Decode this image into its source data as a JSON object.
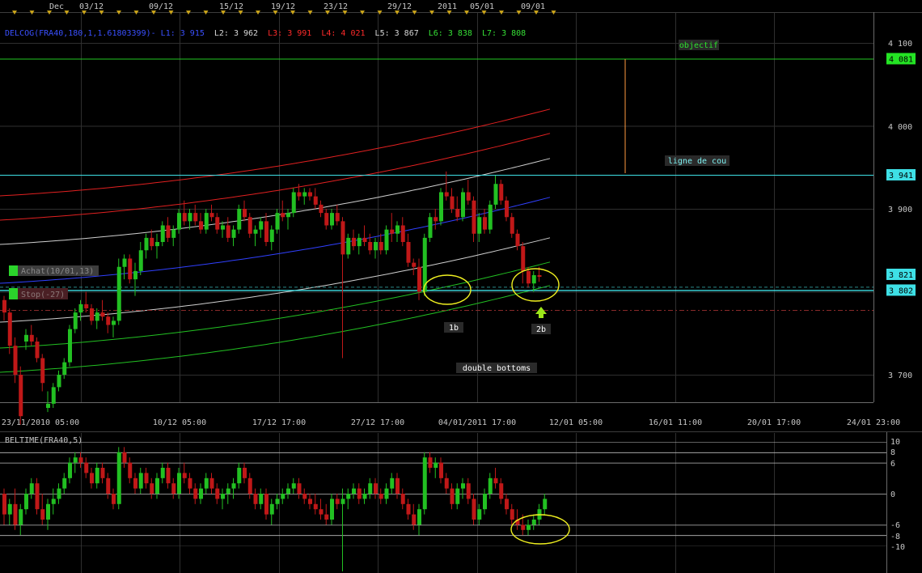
{
  "top_dates": [
    "Dec",
    "03/12",
    "09/12",
    "15/12",
    "19/12",
    "23/12",
    "29/12",
    "2011",
    "05/01",
    "09/01"
  ],
  "main_indicator": {
    "head": "DELCOG(FRA40,180,1,1.61803399)-",
    "levels": [
      {
        "label": "L1: 3 915",
        "color": "#3a50ff"
      },
      {
        "label": "L2: 3 962",
        "color": "#d8d8d8"
      },
      {
        "label": "L3: 3 991",
        "color": "#ff2a2a"
      },
      {
        "label": "L4: 4 021",
        "color": "#ff2a2a"
      },
      {
        "label": "L5: 3 867",
        "color": "#d8d8d8"
      },
      {
        "label": "L6: 3 838",
        "color": "#36e036"
      },
      {
        "label": "L7: 3 808",
        "color": "#36e036"
      }
    ]
  },
  "annotations": {
    "objectif": "objectif",
    "ligne_de_cou": "ligne de cou",
    "b1": "1b",
    "b2": "2b",
    "double_bottoms": "double bottoms"
  },
  "orders": {
    "achat": "Achat(10/01,13)",
    "stop": "Stop(-27)"
  },
  "price_axis": {
    "ticks": [
      "4 100",
      "4 000",
      "3 900",
      "3 700"
    ],
    "tags": [
      {
        "label": "4 081",
        "value": 4081,
        "bg": "#24e424"
      },
      {
        "label": "3 941",
        "value": 3941,
        "bg": "#3ee0e6"
      },
      {
        "label": "3 821",
        "value": 3821,
        "bg": "#3ee0e6"
      },
      {
        "label": "3 802",
        "value": 3802,
        "bg": "#3ee0e6"
      }
    ]
  },
  "bottom_dates": [
    "23/11/2010 05:00",
    "10/12 05:00",
    "17/12 17:00",
    "27/12 17:00",
    "04/01/2011 17:00",
    "12/01 05:00",
    "16/01 11:00",
    "20/01 17:00",
    "24/01 23:00"
  ],
  "sub_indicator": {
    "title": "BELTIME(FRA40,5)",
    "ticks": [
      "10",
      "8",
      "6",
      "0",
      "-6",
      "-8",
      "-10"
    ]
  },
  "chart_data": [
    {
      "type": "candlestick",
      "title": "DELCOG(FRA40,180,1,1.61803399)",
      "ylim": [
        3660,
        4135
      ],
      "series": [
        {
          "name": "L1",
          "value": 3915
        },
        {
          "name": "L2",
          "value": 3962
        },
        {
          "name": "L3",
          "value": 3991
        },
        {
          "name": "L4",
          "value": 4021
        },
        {
          "name": "L5",
          "value": 3867
        },
        {
          "name": "L6",
          "value": 3838
        },
        {
          "name": "L7",
          "value": 3808
        }
      ],
      "horizontal_levels": [
        4081,
        3941,
        3821,
        3802
      ],
      "candles": [
        [
          3790,
          3795,
          3765,
          3775
        ],
        [
          3775,
          3780,
          3725,
          3735
        ],
        [
          3735,
          3745,
          3690,
          3700
        ],
        [
          3700,
          3710,
          3640,
          3650
        ],
        [
          3740,
          3755,
          3730,
          3748
        ],
        [
          3748,
          3760,
          3735,
          3740
        ],
        [
          3740,
          3745,
          3715,
          3720
        ],
        [
          3720,
          3725,
          3680,
          3690
        ],
        [
          3660,
          3680,
          3655,
          3665
        ],
        [
          3665,
          3690,
          3660,
          3685
        ],
        [
          3685,
          3705,
          3680,
          3700
        ],
        [
          3700,
          3720,
          3695,
          3715
        ],
        [
          3715,
          3760,
          3710,
          3755
        ],
        [
          3755,
          3780,
          3750,
          3775
        ],
        [
          3775,
          3790,
          3765,
          3785
        ],
        [
          3785,
          3800,
          3775,
          3780
        ],
        [
          3780,
          3785,
          3760,
          3765
        ],
        [
          3765,
          3780,
          3755,
          3775
        ],
        [
          3775,
          3790,
          3765,
          3770
        ],
        [
          3770,
          3775,
          3750,
          3760
        ],
        [
          3760,
          3770,
          3745,
          3765
        ],
        [
          3765,
          3840,
          3760,
          3830
        ],
        [
          3830,
          3845,
          3815,
          3840
        ],
        [
          3840,
          3845,
          3810,
          3815
        ],
        [
          3815,
          3835,
          3795,
          3825
        ],
        [
          3825,
          3860,
          3820,
          3850
        ],
        [
          3850,
          3870,
          3840,
          3865
        ],
        [
          3865,
          3875,
          3850,
          3855
        ],
        [
          3855,
          3870,
          3840,
          3860
        ],
        [
          3860,
          3885,
          3855,
          3880
        ],
        [
          3880,
          3890,
          3860,
          3865
        ],
        [
          3865,
          3880,
          3855,
          3875
        ],
        [
          3875,
          3900,
          3870,
          3895
        ],
        [
          3895,
          3910,
          3880,
          3885
        ],
        [
          3885,
          3900,
          3875,
          3895
        ],
        [
          3895,
          3905,
          3880,
          3885
        ],
        [
          3885,
          3895,
          3870,
          3875
        ],
        [
          3875,
          3900,
          3870,
          3895
        ],
        [
          3895,
          3905,
          3885,
          3890
        ],
        [
          3890,
          3895,
          3870,
          3875
        ],
        [
          3875,
          3885,
          3865,
          3880
        ],
        [
          3880,
          3890,
          3860,
          3865
        ],
        [
          3865,
          3880,
          3855,
          3875
        ],
        [
          3875,
          3905,
          3870,
          3900
        ],
        [
          3900,
          3910,
          3885,
          3890
        ],
        [
          3890,
          3895,
          3865,
          3870
        ],
        [
          3870,
          3880,
          3855,
          3875
        ],
        [
          3875,
          3890,
          3865,
          3885
        ],
        [
          3885,
          3895,
          3855,
          3860
        ],
        [
          3860,
          3880,
          3850,
          3875
        ],
        [
          3875,
          3900,
          3870,
          3895
        ],
        [
          3895,
          3910,
          3885,
          3890
        ],
        [
          3890,
          3900,
          3875,
          3895
        ],
        [
          3895,
          3925,
          3890,
          3920
        ],
        [
          3920,
          3930,
          3910,
          3915
        ],
        [
          3915,
          3925,
          3905,
          3920
        ],
        [
          3920,
          3925,
          3910,
          3915
        ],
        [
          3915,
          3925,
          3900,
          3905
        ],
        [
          3905,
          3910,
          3890,
          3895
        ],
        [
          3895,
          3900,
          3875,
          3880
        ],
        [
          3880,
          3900,
          3875,
          3895
        ],
        [
          3895,
          3905,
          3880,
          3885
        ],
        [
          3885,
          3890,
          3720,
          3845
        ],
        [
          3845,
          3870,
          3840,
          3865
        ],
        [
          3865,
          3875,
          3850,
          3855
        ],
        [
          3855,
          3870,
          3845,
          3865
        ],
        [
          3865,
          3880,
          3855,
          3860
        ],
        [
          3860,
          3870,
          3845,
          3850
        ],
        [
          3850,
          3865,
          3840,
          3860
        ],
        [
          3860,
          3870,
          3845,
          3850
        ],
        [
          3850,
          3880,
          3845,
          3875
        ],
        [
          3875,
          3895,
          3860,
          3870
        ],
        [
          3870,
          3885,
          3860,
          3880
        ],
        [
          3880,
          3890,
          3855,
          3860
        ],
        [
          3860,
          3870,
          3830,
          3835
        ],
        [
          3835,
          3840,
          3820,
          3830
        ],
        [
          3830,
          3840,
          3790,
          3800
        ],
        [
          3800,
          3870,
          3795,
          3865
        ],
        [
          3865,
          3895,
          3860,
          3890
        ],
        [
          3890,
          3900,
          3875,
          3885
        ],
        [
          3885,
          3925,
          3880,
          3920
        ],
        [
          3920,
          3945,
          3910,
          3915
        ],
        [
          3915,
          3925,
          3895,
          3900
        ],
        [
          3900,
          3915,
          3885,
          3890
        ],
        [
          3890,
          3925,
          3885,
          3920
        ],
        [
          3920,
          3935,
          3905,
          3910
        ],
        [
          3910,
          3915,
          3860,
          3870
        ],
        [
          3870,
          3895,
          3860,
          3890
        ],
        [
          3890,
          3900,
          3870,
          3875
        ],
        [
          3875,
          3910,
          3870,
          3905
        ],
        [
          3905,
          3940,
          3900,
          3930
        ],
        [
          3930,
          3935,
          3905,
          3910
        ],
        [
          3910,
          3915,
          3885,
          3890
        ],
        [
          3890,
          3895,
          3865,
          3870
        ],
        [
          3870,
          3875,
          3850,
          3855
        ],
        [
          3855,
          3860,
          3810,
          3825
        ],
        [
          3825,
          3830,
          3805,
          3810
        ],
        [
          3810,
          3825,
          3800,
          3820
        ],
        [
          3820,
          3830,
          3812,
          3818
        ]
      ]
    },
    {
      "type": "candlestick",
      "title": "BELTIME(FRA40,5)",
      "ylim": [
        -11,
        11
      ],
      "candles": [
        [
          0,
          1,
          -6,
          -4
        ],
        [
          -4,
          -1,
          -6,
          -2
        ],
        [
          -2,
          1,
          -7,
          -6
        ],
        [
          -6,
          -2,
          -8,
          -3
        ],
        [
          -3,
          1,
          -4,
          0
        ],
        [
          0,
          3,
          -1,
          2
        ],
        [
          2,
          3,
          -4,
          -3
        ],
        [
          -3,
          0,
          -6,
          -5
        ],
        [
          -5,
          -1,
          -7,
          -2
        ],
        [
          -2,
          1,
          -4,
          -1
        ],
        [
          -1,
          2,
          -2,
          1
        ],
        [
          1,
          4,
          0,
          3
        ],
        [
          3,
          7,
          2,
          6
        ],
        [
          6,
          8,
          4,
          7
        ],
        [
          7,
          8,
          5,
          6
        ],
        [
          6,
          7,
          3,
          4
        ],
        [
          4,
          5,
          1,
          2
        ],
        [
          2,
          6,
          1,
          5
        ],
        [
          5,
          6,
          2,
          3
        ],
        [
          3,
          4,
          -1,
          0
        ],
        [
          0,
          1,
          -3,
          -2
        ],
        [
          -2,
          9,
          -3,
          8
        ],
        [
          8,
          9,
          5,
          6
        ],
        [
          6,
          7,
          2,
          3
        ],
        [
          3,
          4,
          0,
          1
        ],
        [
          1,
          5,
          0,
          4
        ],
        [
          4,
          5,
          1,
          2
        ],
        [
          2,
          3,
          -1,
          0
        ],
        [
          0,
          4,
          -1,
          3
        ],
        [
          3,
          6,
          2,
          5
        ],
        [
          5,
          6,
          1,
          2
        ],
        [
          2,
          3,
          -1,
          0
        ],
        [
          0,
          5,
          -1,
          4
        ],
        [
          4,
          6,
          2,
          3
        ],
        [
          3,
          4,
          0,
          1
        ],
        [
          1,
          2,
          -2,
          -1
        ],
        [
          -1,
          2,
          -2,
          1
        ],
        [
          1,
          4,
          0,
          3
        ],
        [
          3,
          4,
          0,
          1
        ],
        [
          1,
          2,
          -2,
          -1
        ],
        [
          -1,
          1,
          -3,
          0
        ],
        [
          0,
          2,
          -2,
          1
        ],
        [
          1,
          3,
          -1,
          2
        ],
        [
          2,
          6,
          1,
          5
        ],
        [
          5,
          6,
          2,
          3
        ],
        [
          3,
          4,
          -1,
          0
        ],
        [
          0,
          1,
          -3,
          -2
        ],
        [
          -2,
          1,
          -3,
          0
        ],
        [
          0,
          1,
          -5,
          -4
        ],
        [
          -4,
          -1,
          -6,
          -2
        ],
        [
          -2,
          0,
          -3,
          -1
        ],
        [
          -1,
          1,
          -2,
          0
        ],
        [
          0,
          2,
          -1,
          1
        ],
        [
          1,
          3,
          0,
          2
        ],
        [
          2,
          3,
          -1,
          0
        ],
        [
          0,
          1,
          -2,
          -1
        ],
        [
          -1,
          0,
          -3,
          -2
        ],
        [
          -2,
          0,
          -4,
          -3
        ],
        [
          -3,
          -1,
          -5,
          -4
        ],
        [
          -4,
          -2,
          -6,
          -5
        ],
        [
          -5,
          0,
          -6,
          -1
        ],
        [
          -1,
          0,
          -3,
          -2
        ],
        [
          -2,
          1,
          -18,
          -1
        ],
        [
          -1,
          1,
          -3,
          0
        ],
        [
          0,
          2,
          -1,
          1
        ],
        [
          1,
          2,
          -2,
          -1
        ],
        [
          -1,
          1,
          -2,
          0
        ],
        [
          0,
          3,
          -1,
          2
        ],
        [
          2,
          3,
          -1,
          0
        ],
        [
          0,
          1,
          -2,
          -1
        ],
        [
          -1,
          2,
          -2,
          1
        ],
        [
          1,
          4,
          0,
          3
        ],
        [
          3,
          4,
          -1,
          0
        ],
        [
          0,
          1,
          -3,
          -2
        ],
        [
          -2,
          -1,
          -5,
          -4
        ],
        [
          -4,
          -2,
          -7,
          -6
        ],
        [
          -6,
          -2,
          -8,
          -3
        ],
        [
          -3,
          8,
          -4,
          7
        ],
        [
          7,
          8,
          4,
          5
        ],
        [
          5,
          7,
          3,
          6
        ],
        [
          6,
          7,
          2,
          3
        ],
        [
          3,
          4,
          0,
          1
        ],
        [
          1,
          2,
          -3,
          -2
        ],
        [
          -2,
          2,
          -3,
          1
        ],
        [
          1,
          3,
          -1,
          2
        ],
        [
          2,
          3,
          -2,
          -1
        ],
        [
          -1,
          0,
          -6,
          -5
        ],
        [
          -5,
          -2,
          -6,
          -3
        ],
        [
          -3,
          1,
          -4,
          0
        ],
        [
          0,
          4,
          -1,
          3
        ],
        [
          3,
          5,
          1,
          2
        ],
        [
          2,
          3,
          -2,
          -1
        ],
        [
          -1,
          0,
          -4,
          -3
        ],
        [
          -3,
          -2,
          -6,
          -5
        ],
        [
          -5,
          -3,
          -7,
          -6
        ],
        [
          -6,
          -4,
          -8,
          -7
        ],
        [
          -7,
          -5,
          -8,
          -6
        ],
        [
          -6,
          -4,
          -7,
          -5
        ],
        [
          -5,
          -2,
          -6,
          -3
        ],
        [
          -3,
          0,
          -4,
          -1
        ]
      ]
    }
  ]
}
